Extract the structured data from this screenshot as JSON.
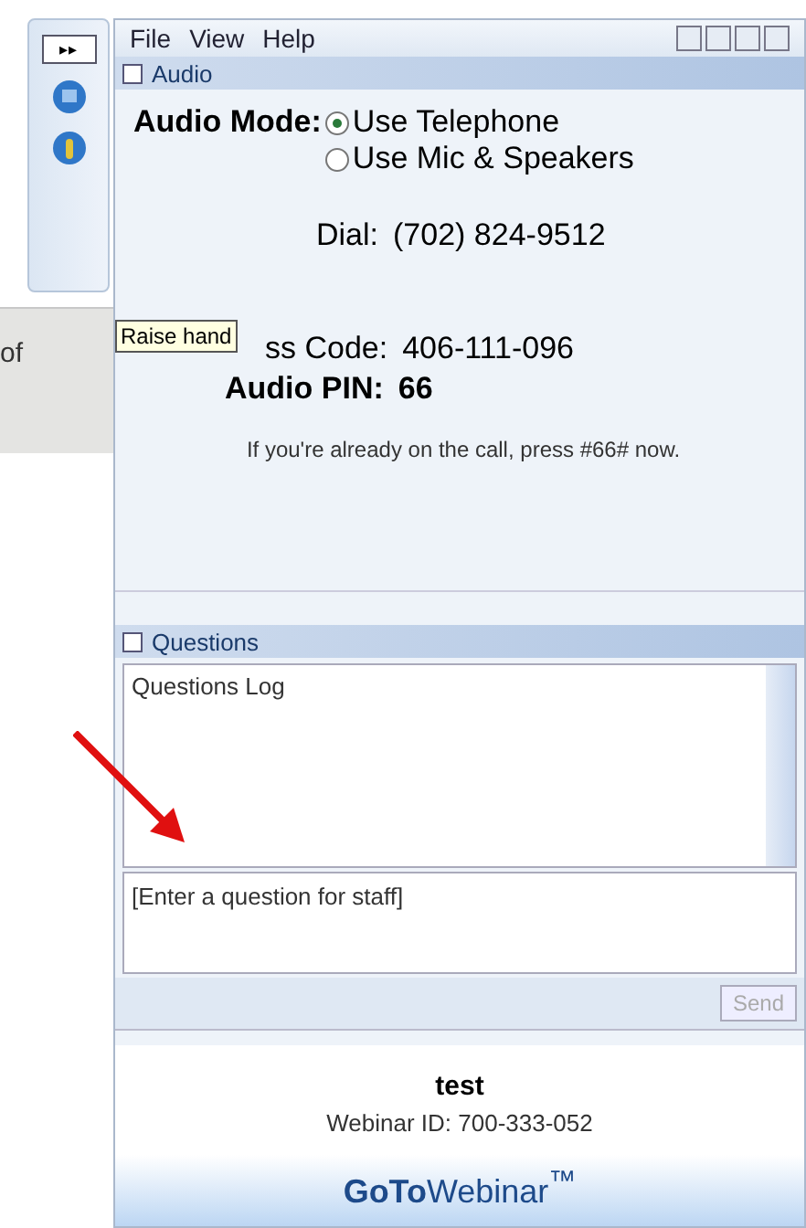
{
  "toolbar": {
    "expand_label": "▸▸"
  },
  "background_window": {
    "text": "of"
  },
  "tooltip": {
    "text": "Raise hand"
  },
  "menu": [
    "File",
    "View",
    "Help"
  ],
  "audio": {
    "title": "Audio",
    "mode_label": "Audio Mode:",
    "options": [
      {
        "label": "Use Telephone",
        "selected": true
      },
      {
        "label": "Use Mic & Speakers",
        "selected": false
      }
    ],
    "dial_label": "Dial:",
    "dial": "(702) 824-9512",
    "code_label": "ss Code:",
    "code": "406-111-096",
    "pin_label": "Audio PIN:",
    "pin": "66",
    "note": "If you're already on the call, press #66# now."
  },
  "questions": {
    "title": "Questions",
    "log": "Questions Log",
    "placeholder": "[Enter a question for staff]",
    "send": "Send",
    "send_disabled": true
  },
  "footer": {
    "name": "test",
    "webinar_id": "Webinar ID: 700-333-052",
    "logo": "**GoTo**Webinar$^{™}$"
  }
}
